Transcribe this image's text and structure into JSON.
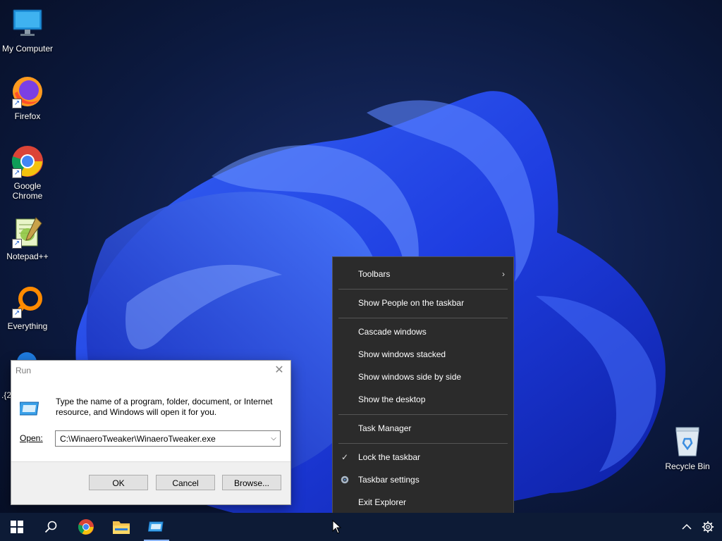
{
  "desktop": {
    "icons": [
      {
        "label": "My Computer"
      },
      {
        "label": "Firefox"
      },
      {
        "label": "Google\nChrome"
      },
      {
        "label": "Notepad++"
      },
      {
        "label": "Everything"
      }
    ],
    "partial_label": ".{2",
    "recycle_bin": "Recycle Bin"
  },
  "run_dialog": {
    "title": "Run",
    "message": "Type the name of a program, folder, document, or Internet resource, and Windows will open it for you.",
    "open_label": "Open:",
    "open_value": "C:\\WinaeroTweaker\\WinaeroTweaker.exe",
    "ok": "OK",
    "cancel": "Cancel",
    "browse": "Browse..."
  },
  "context_menu": {
    "items": [
      {
        "label": "Toolbars"
      },
      {
        "label": "Show People on the taskbar"
      },
      {
        "label": "Cascade windows"
      },
      {
        "label": "Show windows stacked"
      },
      {
        "label": "Show windows side by side"
      },
      {
        "label": "Show the desktop"
      },
      {
        "label": "Task Manager"
      },
      {
        "label": "Lock the taskbar"
      },
      {
        "label": "Taskbar settings"
      },
      {
        "label": "Exit Explorer"
      }
    ]
  },
  "colors": {
    "menu_bg": "#2b2b2b",
    "taskbar_bg": "#0d1b36",
    "wallpaper_accent": "#1e3cff"
  }
}
